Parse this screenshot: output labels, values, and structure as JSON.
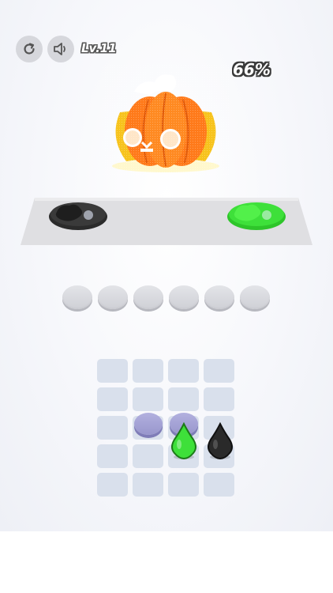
{
  "toolbar": {
    "restart_icon": "restart-icon",
    "sound_icon": "speaker-icon",
    "level_label": "Lv.11"
  },
  "progress": {
    "percent_label": "66%",
    "value": 0.66
  },
  "target_image": {
    "subject": "pumpkin",
    "colors": {
      "body": "#ff7a1a",
      "rind": "#f7c31c",
      "highlight": "#ffffff"
    }
  },
  "palettes": [
    {
      "name": "black-palette",
      "color": "#2b2b2b"
    },
    {
      "name": "green-palette",
      "color": "#3ee03a"
    }
  ],
  "color_slots": {
    "count": 6
  },
  "board": {
    "rows": 5,
    "cols": 4,
    "pucks": [
      {
        "row": 2,
        "col": 1
      },
      {
        "row": 2,
        "col": 2
      }
    ],
    "drops": [
      {
        "row": 3,
        "col": 2,
        "color": "#3ee03a",
        "name": "green-drop"
      },
      {
        "row": 3,
        "col": 3,
        "color": "#252525",
        "name": "black-drop"
      }
    ]
  },
  "colors": {
    "cell": "#d9e0ec",
    "puck": "#a4a2d6",
    "slot": "#d8d9de"
  }
}
